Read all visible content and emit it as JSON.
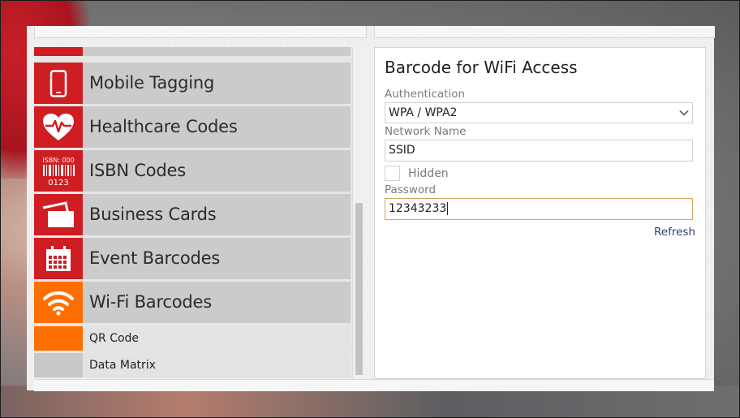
{
  "categories": [
    {
      "label": "Mobile Tagging",
      "icon": "mobile-phone-icon"
    },
    {
      "label": "Healthcare Codes",
      "icon": "heart-pulse-icon"
    },
    {
      "label": "ISBN Codes",
      "icon": "isbn-barcode-icon"
    },
    {
      "label": "Business Cards",
      "icon": "business-cards-icon"
    },
    {
      "label": "Event Barcodes",
      "icon": "calendar-icon"
    },
    {
      "label": "Wi-Fi Barcodes",
      "icon": "wifi-icon",
      "active": true
    }
  ],
  "sub_items": [
    {
      "label": "QR Code",
      "active": true
    },
    {
      "label": "Data Matrix",
      "active": false
    }
  ],
  "isbn_icon_text": {
    "top": "ISBN: 000",
    "bottom": "0123"
  },
  "form": {
    "title": "Barcode for WiFi Access",
    "authentication_label": "Authentication",
    "authentication_value": "WPA / WPA2",
    "network_name_label": "Network Name",
    "network_name_value": "SSID",
    "hidden_label": "Hidden",
    "hidden_checked": false,
    "password_label": "Password",
    "password_value": "12343233",
    "refresh_label": "Refresh"
  },
  "colors": {
    "category_icon_bg": "#cf1d24",
    "active_icon_bg": "#ff6f00",
    "item_bg": "#cbcbcb",
    "focus_border": "#d9a45c",
    "link": "#2b3f72"
  }
}
